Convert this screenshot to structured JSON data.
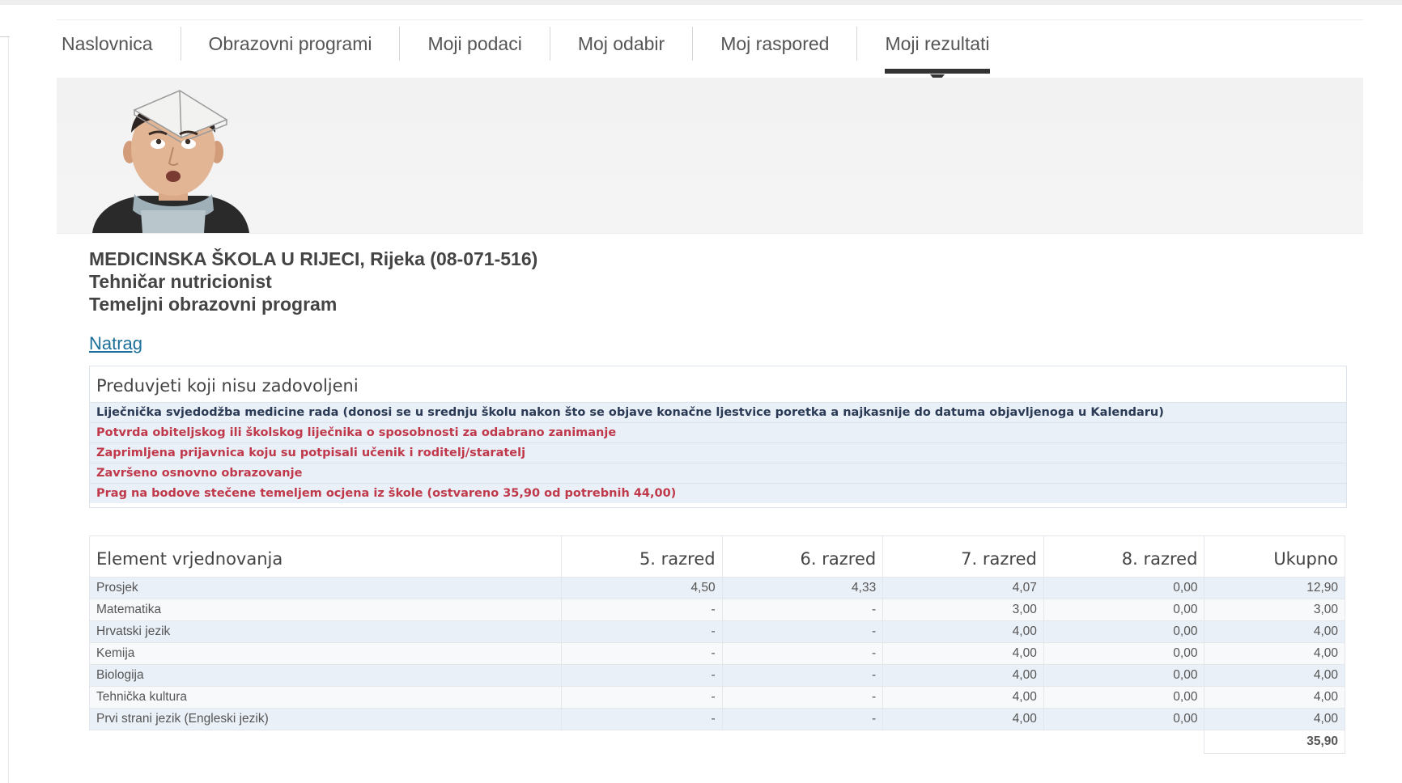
{
  "nav": {
    "tabs": [
      {
        "label": "Naslovnica",
        "active": false
      },
      {
        "label": "Obrazovni programi",
        "active": false
      },
      {
        "label": "Moji podaci",
        "active": false
      },
      {
        "label": "Moj odabir",
        "active": false
      },
      {
        "label": "Moj raspored",
        "active": false
      },
      {
        "label": "Moji rezultati",
        "active": true
      }
    ]
  },
  "school": {
    "name": "MEDICINSKA ŠKOLA U RIJECI, Rijeka (08-071-516)",
    "program": "Tehničar nutricionist",
    "program_type": "Temeljni obrazovni program"
  },
  "back_link": "Natrag",
  "prerequisites": {
    "title": "Preduvjeti koji nisu zadovoljeni",
    "items": [
      {
        "text": "Liječnička svjedodžba medicine rada (donosi se u srednju školu nakon što se objave konačne ljestvice poretka a najkasnije do datuma objavljenoga u Kalendaru)",
        "status": "info"
      },
      {
        "text": "Potvrda obiteljskog ili školskog liječnika o sposobnosti za odabrano zanimanje",
        "status": "unmet"
      },
      {
        "text": "Zaprimljena prijavnica koju su potpisali učenik i roditelj/staratelj",
        "status": "unmet"
      },
      {
        "text": "Završeno osnovno obrazovanje",
        "status": "unmet"
      },
      {
        "text": "Prag na bodove stečene temeljem ocjena iz škole (ostvareno 35,90 od potrebnih 44,00)",
        "status": "unmet"
      }
    ]
  },
  "results": {
    "headers": [
      "Element vrjednovanja",
      "5. razred",
      "6. razred",
      "7. razred",
      "8. razred",
      "Ukupno"
    ],
    "rows": [
      [
        "Prosjek",
        "4,50",
        "4,33",
        "4,07",
        "0,00",
        "12,90"
      ],
      [
        "Matematika",
        "-",
        "-",
        "3,00",
        "0,00",
        "3,00"
      ],
      [
        "Hrvatski jezik",
        "-",
        "-",
        "4,00",
        "0,00",
        "4,00"
      ],
      [
        "Kemija",
        "-",
        "-",
        "4,00",
        "0,00",
        "4,00"
      ],
      [
        "Biologija",
        "-",
        "-",
        "4,00",
        "0,00",
        "4,00"
      ],
      [
        "Tehnička kultura",
        "-",
        "-",
        "4,00",
        "0,00",
        "4,00"
      ],
      [
        "Prvi strani jezik (Engleski jezik)",
        "-",
        "-",
        "4,00",
        "0,00",
        "4,00"
      ]
    ],
    "total": "35,90"
  },
  "colors": {
    "unmet_text": "#c0394b",
    "info_text": "#2b3a55",
    "row_stripe": "#eaf0f7",
    "active_tab_marker": "#333333"
  },
  "icons": {
    "avatar": "student-with-book-on-head"
  }
}
